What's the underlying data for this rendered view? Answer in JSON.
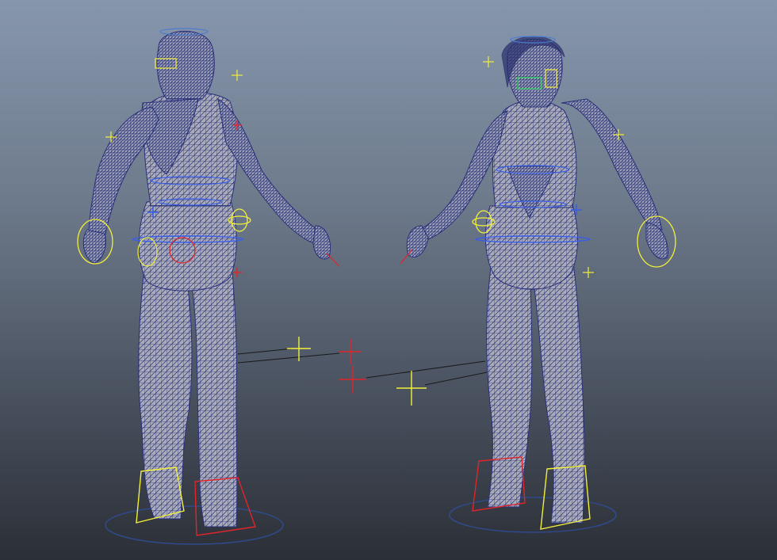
{
  "viewport": {
    "kind": "3d-rig-viewport",
    "shading": "wireframe-on-shaded",
    "background_top": "#8696ad",
    "background_bottom": "#2b2f36"
  },
  "colors": {
    "mesh_fill": "#a9acb8",
    "wireframe": "#29307a",
    "control_yellow": "#f2ef3a",
    "control_red": "#e0252b",
    "control_blue": "#3a5ee8",
    "ground_circle": "#2f4a8a",
    "pole_line": "#1a1a1a"
  },
  "figures": [
    {
      "name": "character-back-view",
      "facing": "back"
    },
    {
      "name": "character-front-view",
      "facing": "front"
    }
  ],
  "icons": {
    "controls": [
      "translate-cross-icon",
      "pole-vector-icon",
      "ik-foot-box-icon",
      "wrist-circle-icon",
      "ground-circle-icon"
    ]
  }
}
